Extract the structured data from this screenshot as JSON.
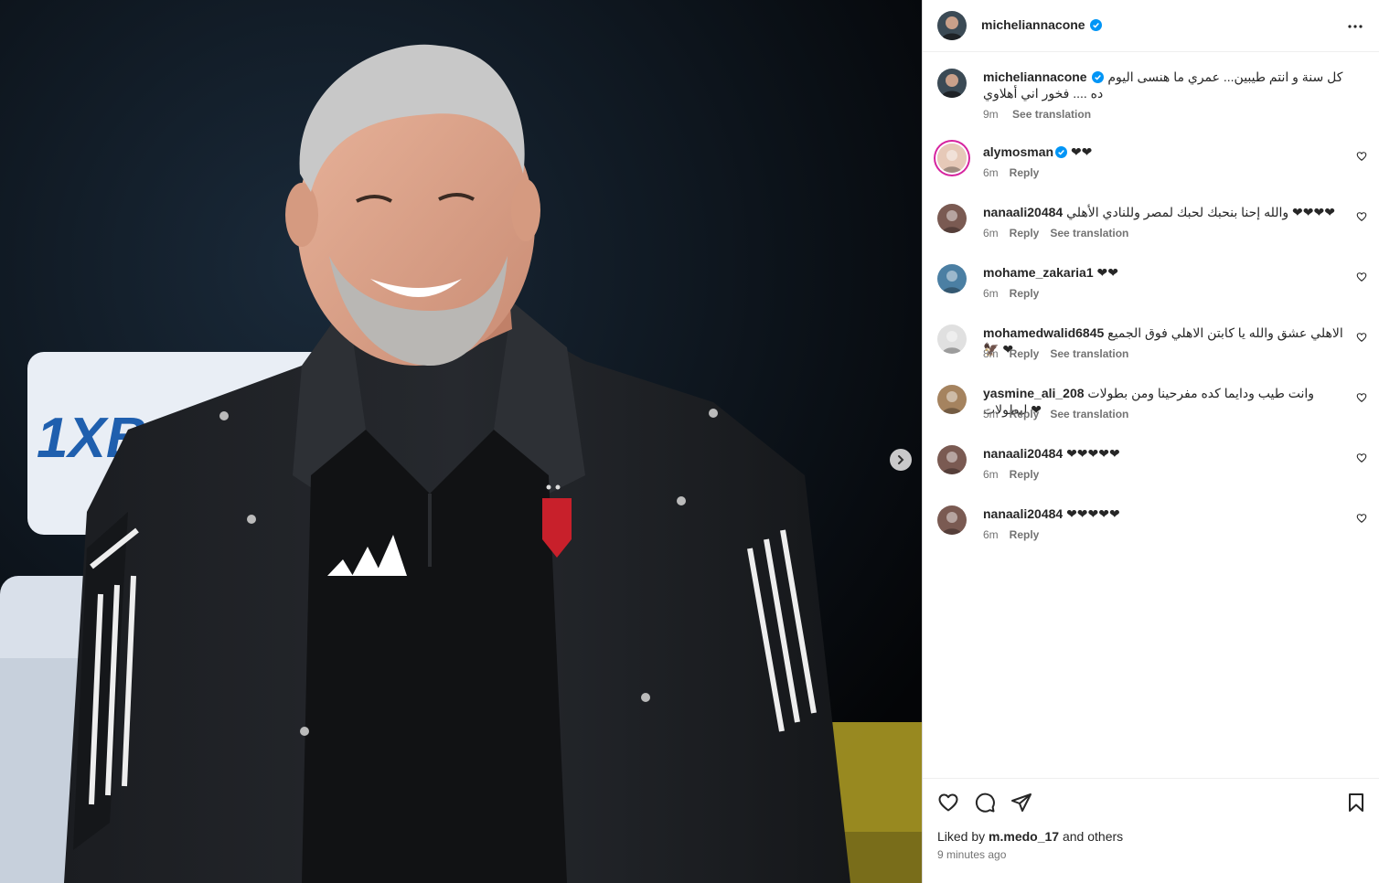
{
  "post": {
    "author": "micheliannacone",
    "caption": "كل سنة و انتم طيبين... عمري ما هنسى اليوم ده .... فخور اني أهلاوي",
    "caption_time": "9m",
    "caption_action": "See translation",
    "photo_text": "1XB"
  },
  "comments": [
    {
      "user": "alymosman",
      "verified": true,
      "text": "❤❤",
      "time": "6m",
      "reply": "Reply",
      "translate": ""
    },
    {
      "user": "nanaali20484",
      "verified": false,
      "text": "والله إحنا بنحبك لحبك لمصر وللنادي الأهلي ❤❤❤❤",
      "time": "6m",
      "reply": "Reply",
      "translate": "See translation"
    },
    {
      "user": "mohame_zakaria1",
      "verified": false,
      "text": "❤❤",
      "time": "6m",
      "reply": "Reply",
      "translate": ""
    },
    {
      "user": "mohamedwalid6845",
      "verified": false,
      "text": "الاهلي عشق والله يا كابتن الاهلي فوق الجميع 🦅 ❤",
      "time": "8m",
      "reply": "Reply",
      "translate": "See translation"
    },
    {
      "user": "yasmine_ali_208",
      "verified": false,
      "text": "وانت طيب ودايما كده مفرحينا ومن بطولات لبطولات ❤",
      "time": "5m",
      "reply": "Reply",
      "translate": "See translation"
    },
    {
      "user": "nanaali20484",
      "verified": false,
      "text": "❤❤❤❤❤",
      "time": "6m",
      "reply": "Reply",
      "translate": ""
    },
    {
      "user": "nanaali20484",
      "verified": false,
      "text": "❤❤❤❤❤",
      "time": "6m",
      "reply": "Reply",
      "translate": ""
    }
  ],
  "likes": {
    "prefix": "Liked by",
    "user": "m.medo_17",
    "suffix": "and others"
  },
  "timestamp": "9 minutes ago",
  "icons": {
    "more": "more-options-icon",
    "next": "chevron-right-icon",
    "like": "heart-icon",
    "comment": "comment-icon",
    "share": "send-icon",
    "save": "bookmark-icon",
    "verified": "verified-badge-icon"
  },
  "colors": {
    "verified": "#0095f6",
    "muted": "#737373",
    "text": "#262626",
    "border": "#dbdbdb"
  }
}
